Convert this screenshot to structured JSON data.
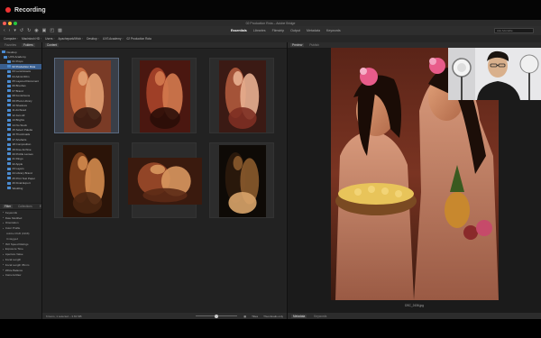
{
  "recording": {
    "label": "Recording"
  },
  "window": {
    "title": "02 Production Rota – Adobe Bridge"
  },
  "toolbar": {
    "icons": [
      "back-icon",
      "forward-icon",
      "rotate-left-icon",
      "rotate-right-icon",
      "camera-icon",
      "filter-icon",
      "folder-icon",
      "refine-icon"
    ],
    "workspaces": [
      "Essentials",
      "Libraries",
      "Filmstrip",
      "Output",
      "Metadata",
      "Keywords"
    ],
    "search_placeholder": "Ask Adorable"
  },
  "breadcrumb": [
    "Computer",
    "Macintosh HD",
    "Users",
    "Apachepark/Mitch",
    "Desktop",
    "UXS Academy",
    "02 Production Rota"
  ],
  "left_panel": {
    "tabs": [
      "Favorites",
      "Folders"
    ],
    "folders": [
      "Desktop",
      "UXS Academy",
      "01 Props",
      "02 Production Rota",
      "03 Lens/Assets",
      "04 Admin/Film",
      "05 Layered Document",
      "06 Brushes",
      "07 Brand",
      "08 Fonts/Icons",
      "09 Photo Library",
      "10 Shadows",
      "11 Archived",
      "12 Jam All",
      "13 Brights",
      "14 No Stock",
      "15 Select Palette",
      "16 Thumbnails",
      "17 Artefacts",
      "18 Composition",
      "19 Free Archive",
      "20 Profile Lenses",
      "21 Ringo",
      "22 Apple",
      "23 Layers",
      "24 Library Brand",
      "25 Print Test Paper",
      "26 Final Export",
      "Wedding"
    ],
    "selected_folder_index": 3
  },
  "filter_panel": {
    "tabs": [
      "Filter",
      "Collections",
      "Export"
    ],
    "rows": [
      {
        "label": "Keywords",
        "sub": false
      },
      {
        "label": "Date Modified",
        "sub": false
      },
      {
        "label": "Orientation",
        "sub": false
      },
      {
        "label": "Color Profile",
        "sub": false
      },
      {
        "label": "Adobe RGB (1998)",
        "sub": true
      },
      {
        "label": "Untagged",
        "sub": true
      },
      {
        "label": "ISO Speed Ratings",
        "sub": false
      },
      {
        "label": "Exposure Time",
        "sub": false
      },
      {
        "label": "Aperture Value",
        "sub": false
      },
      {
        "label": "Focal Length",
        "sub": false
      },
      {
        "label": "Focal Length 35mm",
        "sub": false
      },
      {
        "label": "White Balance",
        "sub": false
      },
      {
        "label": "Camera Raw",
        "sub": false
      }
    ]
  },
  "content_panel": {
    "tabs": [
      "Content"
    ],
    "thumbnails": [
      {
        "name": "thumb-dancers-orange",
        "selected": true,
        "palette": [
          "#7a3b26",
          "#c86c3f",
          "#e2a173",
          "#3a1c12"
        ]
      },
      {
        "name": "thumb-dancers-red",
        "selected": false,
        "palette": [
          "#4a1710",
          "#a8442a",
          "#d47a4f",
          "#2a0d08"
        ]
      },
      {
        "name": "thumb-woman-flower",
        "selected": false,
        "palette": [
          "#3b1a14",
          "#b05a3c",
          "#e9b091",
          "#7e2f22"
        ]
      },
      {
        "name": "thumb-palm-woman",
        "selected": false,
        "palette": [
          "#2b1408",
          "#7c3e1c",
          "#d28a4e",
          "#4a2612"
        ]
      },
      {
        "name": "thumb-group-lying",
        "selected": false,
        "palette": [
          "#3a1a0e",
          "#9c4a2a",
          "#d9975f",
          "#5c2a16"
        ]
      },
      {
        "name": "thumb-dark-fire",
        "selected": false,
        "palette": [
          "#0e0a06",
          "#2c1a0c",
          "#8a5a2c",
          "#d9a46a"
        ]
      }
    ],
    "footer_status": "6 items, 1 selected – 3.63 MB",
    "footer_right": [
      "Titles",
      "Thumbnails only"
    ],
    "zoom_level": 0.5
  },
  "preview_panel": {
    "tabs": [
      "Preview",
      "Publish"
    ],
    "caption": "DSC_2436.jpg",
    "footer_tabs": [
      "Metadata",
      "Keywords"
    ]
  },
  "colors": {
    "accent": "#3a5f8f",
    "folder_icon": "#4b8bd0",
    "record_dot": "#e33"
  }
}
